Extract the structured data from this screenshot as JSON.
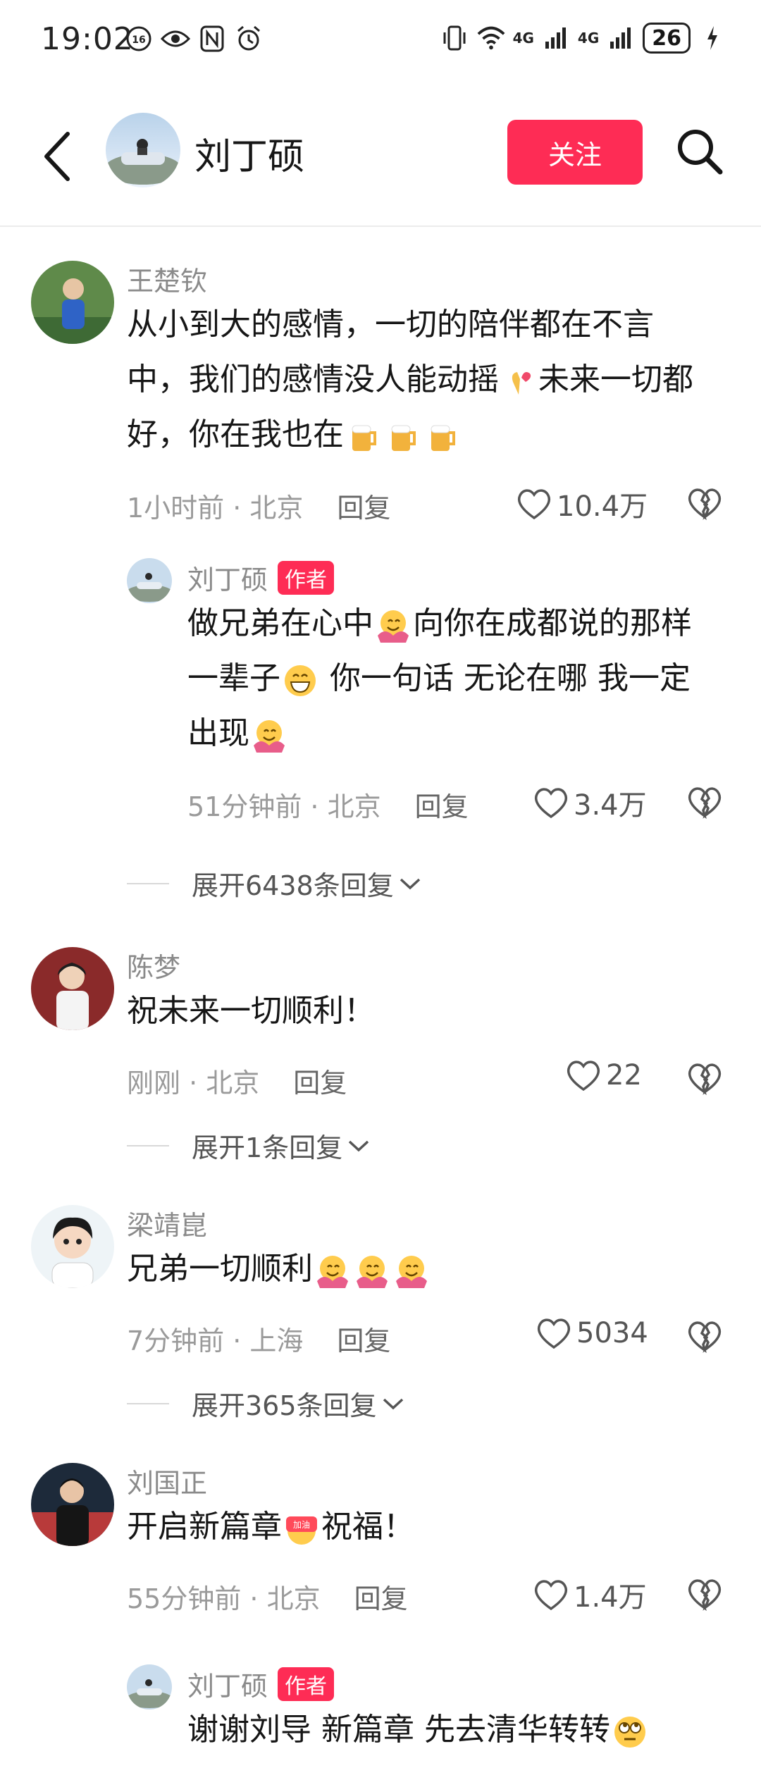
{
  "status": {
    "time": "19:02",
    "net1": "4G",
    "net2": "4G",
    "battery": "26"
  },
  "header": {
    "title": "刘丁硕",
    "follow_label": "关注"
  },
  "comments": [
    {
      "user": "王楚钦",
      "text_a": "从小到大的感情，一切的陪伴都在不言",
      "text_b": "中，我们的感情没人能动摇",
      "text_c": "未来一切都",
      "text_d": "好，你在我也在",
      "time": "1小时前 · 北京",
      "reply": "回复",
      "likes": "10.4万",
      "sub": {
        "user": "刘丁硕",
        "tag": "作者",
        "text_a": "做兄弟在心中",
        "text_b": "向你在成都说的那样",
        "text_c": "一辈子",
        "text_d": " 你一句话 无论在哪 我一定",
        "text_e": "出现",
        "time": "51分钟前 · 北京",
        "reply": "回复",
        "likes": "3.4万"
      },
      "expand": "展开6438条回复"
    },
    {
      "user": "陈梦",
      "text": "祝未来一切顺利！",
      "time": "刚刚 · 北京",
      "reply": "回复",
      "likes": "22",
      "expand": "展开1条回复"
    },
    {
      "user": "梁靖崑",
      "text": "兄弟一切顺利",
      "time": "7分钟前 · 上海",
      "reply": "回复",
      "likes": "5034",
      "expand": "展开365条回复"
    },
    {
      "user": "刘国正",
      "text_a": "开启新篇章",
      "text_b": "祝福！",
      "emoji_label": "加油",
      "time": "55分钟前 · 北京",
      "reply": "回复",
      "likes": "1.4万",
      "sub": {
        "user": "刘丁硕",
        "tag": "作者",
        "text": "谢谢刘导 新篇章 先去清华转转"
      }
    }
  ]
}
